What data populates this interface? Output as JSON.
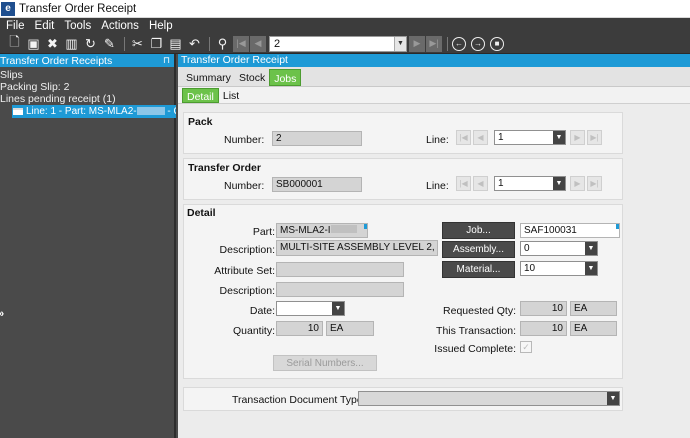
{
  "window": {
    "logo": "e",
    "title": "Transfer Order Receipt"
  },
  "menu": [
    "File",
    "Edit",
    "Tools",
    "Actions",
    "Help"
  ],
  "toolbar": {
    "record_value": "2"
  },
  "left_panel": {
    "title": "Transfer Order Receipts",
    "tree": [
      "Slips",
      "Packing Slip: 2",
      "Lines pending receipt (1)"
    ],
    "selected_prefix": "Line: 1 - Part: MS-MLA2-",
    "selected_suffix": " - Qty:"
  },
  "main": {
    "title": "Transfer Order Receipt",
    "tabs": [
      "Summary",
      "Stock",
      "Jobs"
    ],
    "subtabs": [
      "Detail",
      "List"
    ]
  },
  "pack": {
    "title": "Pack",
    "number_label": "Number:",
    "number": "2",
    "line_label": "Line:",
    "line": "1"
  },
  "transfer_order": {
    "title": "Transfer Order",
    "number_label": "Number:",
    "number": "SB000001",
    "line_label": "Line:",
    "line": "1"
  },
  "detail": {
    "title": "Detail",
    "part_label": "Part:",
    "part": "MS-MLA2-I",
    "desc_label": "Description:",
    "desc": "MULTI-SITE ASSEMBLY LEVEL 2,",
    "attr_label": "Attribute Set:",
    "attr": "",
    "desc2_label": "Description:",
    "desc2": "",
    "date_label": "Date:",
    "date": "",
    "qty_label": "Quantity:",
    "qty": "10",
    "qty_uom": "EA",
    "serial_btn": "Serial Numbers...",
    "job_btn": "Job...",
    "job": "SAF100031",
    "assembly_btn": "Assembly...",
    "assembly": "0",
    "material_btn": "Material...",
    "material": "10",
    "req_label": "Requested Qty:",
    "req": "10",
    "req_uom": "EA",
    "this_label": "This Transaction:",
    "this": "10",
    "this_uom": "EA",
    "issued_label": "Issued Complete:"
  },
  "transaction": {
    "label": "Transaction Document Type:",
    "value": ""
  }
}
